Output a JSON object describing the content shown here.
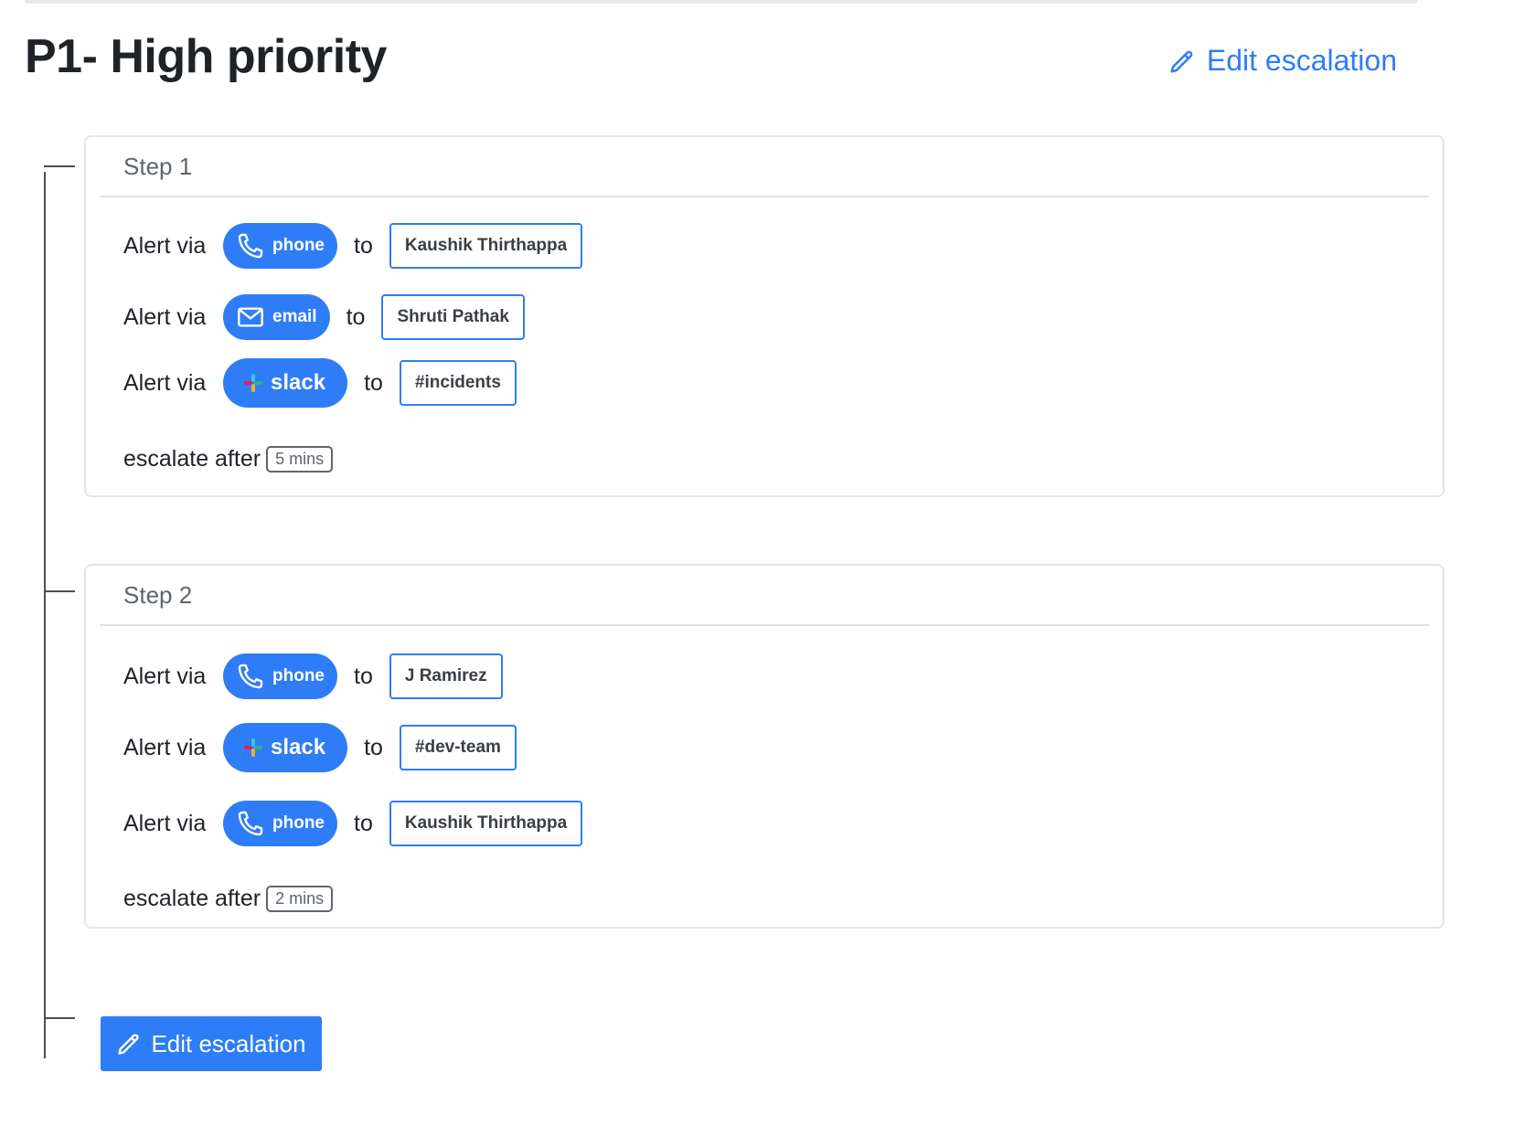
{
  "title": "P1- High priority",
  "edit_label": "Edit escalation",
  "alert_label": "Alert via",
  "to_label": "to",
  "escalate_label": "escalate after",
  "colors": {
    "accent": "#2f7df6",
    "text": "#1f2328",
    "muted": "#5f656d",
    "border": "#e3e5e8"
  },
  "steps": [
    {
      "label": "Step 1",
      "alerts": [
        {
          "channel": "phone",
          "icon": "phone-icon",
          "target": "Kaushik Thirthappa"
        },
        {
          "channel": "email",
          "icon": "mail-icon",
          "target": "Shruti Pathak"
        },
        {
          "channel": "slack",
          "icon": "slack-icon",
          "target": "#incidents"
        }
      ],
      "escalate_after": "5 mins"
    },
    {
      "label": "Step 2",
      "alerts": [
        {
          "channel": "phone",
          "icon": "phone-icon",
          "target": "J Ramirez"
        },
        {
          "channel": "slack",
          "icon": "slack-icon",
          "target": "#dev-team"
        },
        {
          "channel": "phone",
          "icon": "phone-icon",
          "target": "Kaushik Thirthappa"
        }
      ],
      "escalate_after": "2 mins"
    }
  ]
}
